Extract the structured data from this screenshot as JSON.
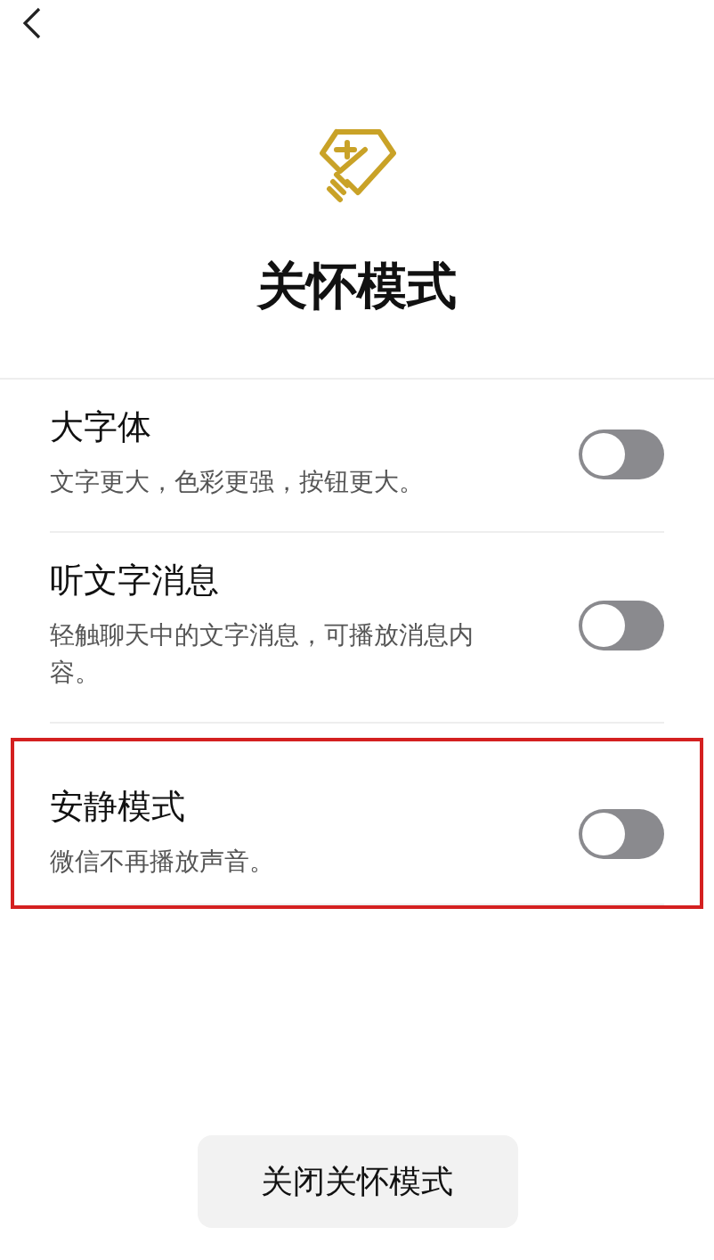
{
  "title": "关怀模式",
  "settings": [
    {
      "label": "大字体",
      "description": "文字更大，色彩更强，按钮更大。",
      "on": false,
      "highlighted": false
    },
    {
      "label": "听文字消息",
      "description": "轻触聊天中的文字消息，可播放消息内容。",
      "on": false,
      "highlighted": false
    },
    {
      "label": "安静模式",
      "description": "微信不再播放声音。",
      "on": false,
      "highlighted": true
    }
  ],
  "button": "关闭关怀模式"
}
